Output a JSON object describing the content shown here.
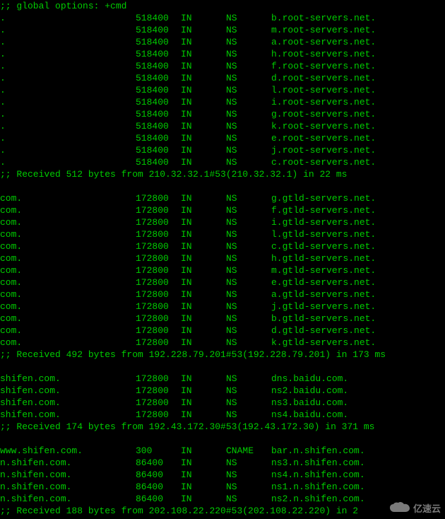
{
  "header": ";; global options: +cmd",
  "sections": [
    {
      "records": [
        {
          "name": ".",
          "ttl": "518400",
          "class": "IN",
          "type": "NS",
          "data": "b.root-servers.net."
        },
        {
          "name": ".",
          "ttl": "518400",
          "class": "IN",
          "type": "NS",
          "data": "m.root-servers.net."
        },
        {
          "name": ".",
          "ttl": "518400",
          "class": "IN",
          "type": "NS",
          "data": "a.root-servers.net."
        },
        {
          "name": ".",
          "ttl": "518400",
          "class": "IN",
          "type": "NS",
          "data": "h.root-servers.net."
        },
        {
          "name": ".",
          "ttl": "518400",
          "class": "IN",
          "type": "NS",
          "data": "f.root-servers.net."
        },
        {
          "name": ".",
          "ttl": "518400",
          "class": "IN",
          "type": "NS",
          "data": "d.root-servers.net."
        },
        {
          "name": ".",
          "ttl": "518400",
          "class": "IN",
          "type": "NS",
          "data": "l.root-servers.net."
        },
        {
          "name": ".",
          "ttl": "518400",
          "class": "IN",
          "type": "NS",
          "data": "i.root-servers.net."
        },
        {
          "name": ".",
          "ttl": "518400",
          "class": "IN",
          "type": "NS",
          "data": "g.root-servers.net."
        },
        {
          "name": ".",
          "ttl": "518400",
          "class": "IN",
          "type": "NS",
          "data": "k.root-servers.net."
        },
        {
          "name": ".",
          "ttl": "518400",
          "class": "IN",
          "type": "NS",
          "data": "e.root-servers.net."
        },
        {
          "name": ".",
          "ttl": "518400",
          "class": "IN",
          "type": "NS",
          "data": "j.root-servers.net."
        },
        {
          "name": ".",
          "ttl": "518400",
          "class": "IN",
          "type": "NS",
          "data": "c.root-servers.net."
        }
      ],
      "footer": ";; Received 512 bytes from 210.32.32.1#53(210.32.32.1) in 22 ms"
    },
    {
      "records": [
        {
          "name": "com.",
          "ttl": "172800",
          "class": "IN",
          "type": "NS",
          "data": "g.gtld-servers.net."
        },
        {
          "name": "com.",
          "ttl": "172800",
          "class": "IN",
          "type": "NS",
          "data": "f.gtld-servers.net."
        },
        {
          "name": "com.",
          "ttl": "172800",
          "class": "IN",
          "type": "NS",
          "data": "i.gtld-servers.net."
        },
        {
          "name": "com.",
          "ttl": "172800",
          "class": "IN",
          "type": "NS",
          "data": "l.gtld-servers.net."
        },
        {
          "name": "com.",
          "ttl": "172800",
          "class": "IN",
          "type": "NS",
          "data": "c.gtld-servers.net."
        },
        {
          "name": "com.",
          "ttl": "172800",
          "class": "IN",
          "type": "NS",
          "data": "h.gtld-servers.net."
        },
        {
          "name": "com.",
          "ttl": "172800",
          "class": "IN",
          "type": "NS",
          "data": "m.gtld-servers.net."
        },
        {
          "name": "com.",
          "ttl": "172800",
          "class": "IN",
          "type": "NS",
          "data": "e.gtld-servers.net."
        },
        {
          "name": "com.",
          "ttl": "172800",
          "class": "IN",
          "type": "NS",
          "data": "a.gtld-servers.net."
        },
        {
          "name": "com.",
          "ttl": "172800",
          "class": "IN",
          "type": "NS",
          "data": "j.gtld-servers.net."
        },
        {
          "name": "com.",
          "ttl": "172800",
          "class": "IN",
          "type": "NS",
          "data": "b.gtld-servers.net."
        },
        {
          "name": "com.",
          "ttl": "172800",
          "class": "IN",
          "type": "NS",
          "data": "d.gtld-servers.net."
        },
        {
          "name": "com.",
          "ttl": "172800",
          "class": "IN",
          "type": "NS",
          "data": "k.gtld-servers.net."
        }
      ],
      "footer": ";; Received 492 bytes from 192.228.79.201#53(192.228.79.201) in 173 ms"
    },
    {
      "records": [
        {
          "name": "shifen.com.",
          "ttl": "172800",
          "class": "IN",
          "type": "NS",
          "data": "dns.baidu.com."
        },
        {
          "name": "shifen.com.",
          "ttl": "172800",
          "class": "IN",
          "type": "NS",
          "data": "ns2.baidu.com."
        },
        {
          "name": "shifen.com.",
          "ttl": "172800",
          "class": "IN",
          "type": "NS",
          "data": "ns3.baidu.com."
        },
        {
          "name": "shifen.com.",
          "ttl": "172800",
          "class": "IN",
          "type": "NS",
          "data": "ns4.baidu.com."
        }
      ],
      "footer": ";; Received 174 bytes from 192.43.172.30#53(192.43.172.30) in 371 ms"
    },
    {
      "records": [
        {
          "name": "www.shifen.com.",
          "ttl": "300",
          "class": "IN",
          "type": "CNAME",
          "data": "bar.n.shifen.com."
        },
        {
          "name": "n.shifen.com.",
          "ttl": "86400",
          "class": "IN",
          "type": "NS",
          "data": "ns3.n.shifen.com."
        },
        {
          "name": "n.shifen.com.",
          "ttl": "86400",
          "class": "IN",
          "type": "NS",
          "data": "ns4.n.shifen.com."
        },
        {
          "name": "n.shifen.com.",
          "ttl": "86400",
          "class": "IN",
          "type": "NS",
          "data": "ns1.n.shifen.com."
        },
        {
          "name": "n.shifen.com.",
          "ttl": "86400",
          "class": "IN",
          "type": "NS",
          "data": "ns2.n.shifen.com."
        }
      ],
      "footer": ";; Received 188 bytes from 202.108.22.220#53(202.108.22.220) in 2"
    }
  ],
  "watermark": {
    "text": "亿速云"
  }
}
